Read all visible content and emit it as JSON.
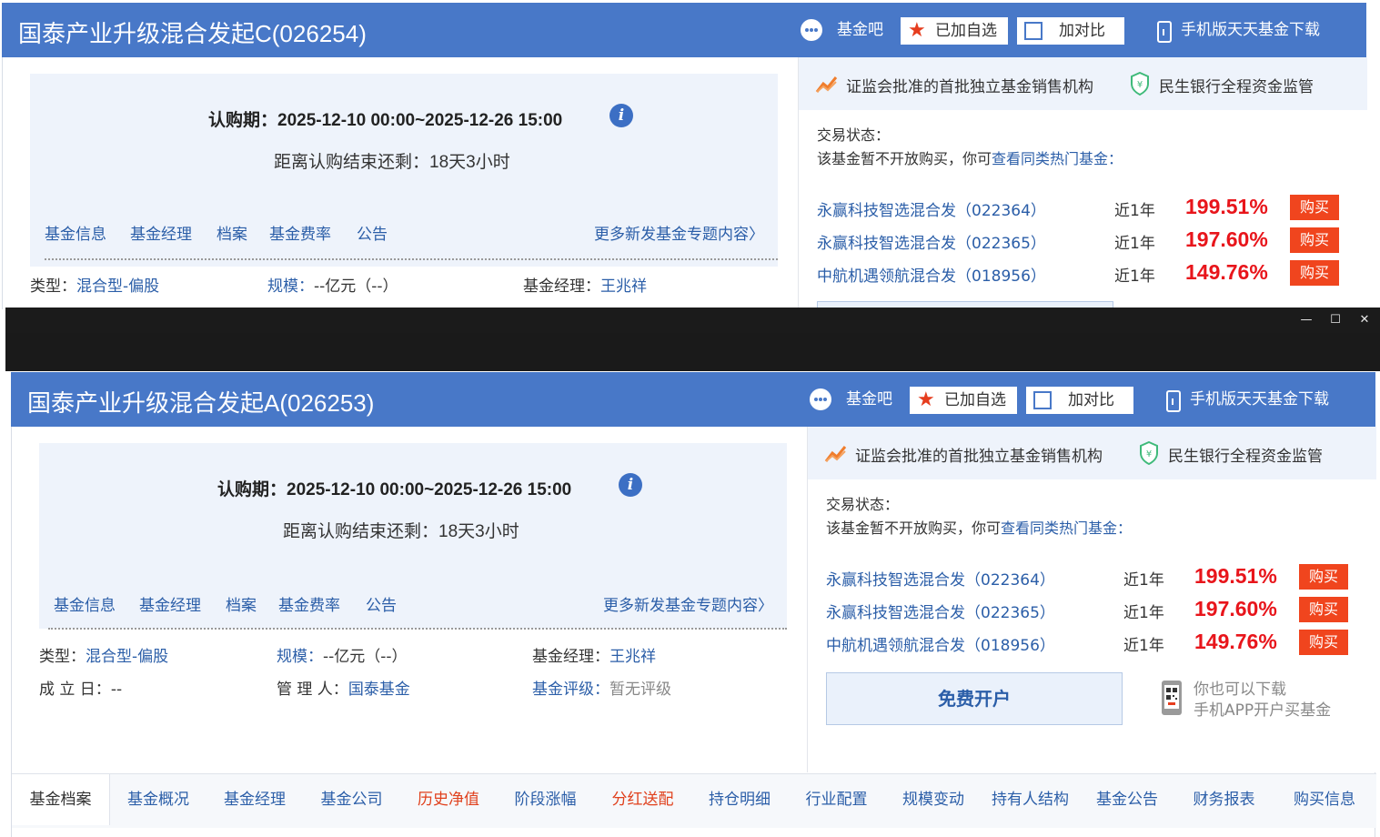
{
  "colors": {
    "header_blue": "#4878c8",
    "link_blue": "#2b5ea8",
    "pct_red": "#e8151b",
    "buy_orange": "#f0451e"
  },
  "windowC": {
    "title": "国泰产业升级混合发起C(026254)",
    "header": {
      "forum": "基金吧",
      "fav": "已加自选",
      "compare": "加对比",
      "mobile": "手机版天天基金下载"
    },
    "period_label": "认购期：",
    "period_value": "2025-12-10 00:00~2025-12-26 15:00",
    "remain_label": "距离认购结束还剩：",
    "remain_value": "18天3小时",
    "nav": [
      "基金信息",
      "基金经理",
      "档案",
      "基金费率",
      "公告"
    ],
    "more": "更多新发基金专题内容",
    "info": {
      "type_label": "类型：",
      "type_value": "混合型-偏股",
      "scale_label": "规模：",
      "scale_value": "--亿元（--）",
      "manager_label": "基金经理：",
      "manager_value": "王兆祥"
    },
    "assure": {
      "a1": "证监会批准的首批独立基金销售机构",
      "a2": "民生银行全程资金监管"
    },
    "status_label": "交易状态：",
    "status_text": "该基金暂不开放购买，你可",
    "status_link": "查看同类热门基金",
    "status_colon": "：",
    "funds": [
      {
        "name": "永赢科技智选混合发（022364）",
        "period": "近1年",
        "pct": "199.51%",
        "buy": "购买"
      },
      {
        "name": "永赢科技智选混合发（022365）",
        "period": "近1年",
        "pct": "197.60%",
        "buy": "购买"
      },
      {
        "name": "中航机遇领航混合发（018956）",
        "period": "近1年",
        "pct": "149.76%",
        "buy": "购买"
      }
    ]
  },
  "windowA": {
    "titlebar": {
      "minimize": "—",
      "maximize": "☐",
      "close": "✕"
    },
    "title": "国泰产业升级混合发起A(026253)",
    "header": {
      "forum": "基金吧",
      "fav": "已加自选",
      "compare": "加对比",
      "mobile": "手机版天天基金下载"
    },
    "period_label": "认购期：",
    "period_value": "2025-12-10 00:00~2025-12-26 15:00",
    "remain_label": "距离认购结束还剩：",
    "remain_value": "18天3小时",
    "nav": [
      "基金信息",
      "基金经理",
      "档案",
      "基金费率",
      "公告"
    ],
    "more": "更多新发基金专题内容",
    "info": {
      "type_label": "类型：",
      "type_value": "混合型-偏股",
      "scale_label": "规模：",
      "scale_value": "--亿元（--）",
      "manager_label": "基金经理：",
      "manager_value": "王兆祥",
      "setup_label": "成 立 日：",
      "setup_value": "--",
      "admin_label": "管 理 人：",
      "admin_value": "国泰基金",
      "rating_label": "基金评级：",
      "rating_value": "暂无评级"
    },
    "assure": {
      "a1": "证监会批准的首批独立基金销售机构",
      "a2": "民生银行全程资金监管"
    },
    "status_label": "交易状态：",
    "status_text": "该基金暂不开放购买，你可",
    "status_link": "查看同类热门基金",
    "status_colon": "：",
    "funds": [
      {
        "name": "永赢科技智选混合发（022364）",
        "period": "近1年",
        "pct": "199.51%",
        "buy": "购买"
      },
      {
        "name": "永赢科技智选混合发（022365）",
        "period": "近1年",
        "pct": "197.60%",
        "buy": "购买"
      },
      {
        "name": "中航机遇领航混合发（018956）",
        "period": "近1年",
        "pct": "149.76%",
        "buy": "购买"
      }
    ],
    "open_account": "免费开户",
    "app_line1": "你也可以下载",
    "app_line2": "手机APP开户买基金",
    "tabs": [
      {
        "label": "基金档案",
        "style": "active"
      },
      {
        "label": "基金概况",
        "style": ""
      },
      {
        "label": "基金经理",
        "style": ""
      },
      {
        "label": "基金公司",
        "style": ""
      },
      {
        "label": "历史净值",
        "style": "red"
      },
      {
        "label": "阶段涨幅",
        "style": ""
      },
      {
        "label": "分红送配",
        "style": "red"
      },
      {
        "label": "持仓明细",
        "style": ""
      },
      {
        "label": "行业配置",
        "style": ""
      },
      {
        "label": "规模变动",
        "style": ""
      },
      {
        "label": "持有人结构",
        "style": ""
      },
      {
        "label": "基金公告",
        "style": ""
      },
      {
        "label": "财务报表",
        "style": ""
      },
      {
        "label": "购买信息",
        "style": ""
      }
    ]
  }
}
